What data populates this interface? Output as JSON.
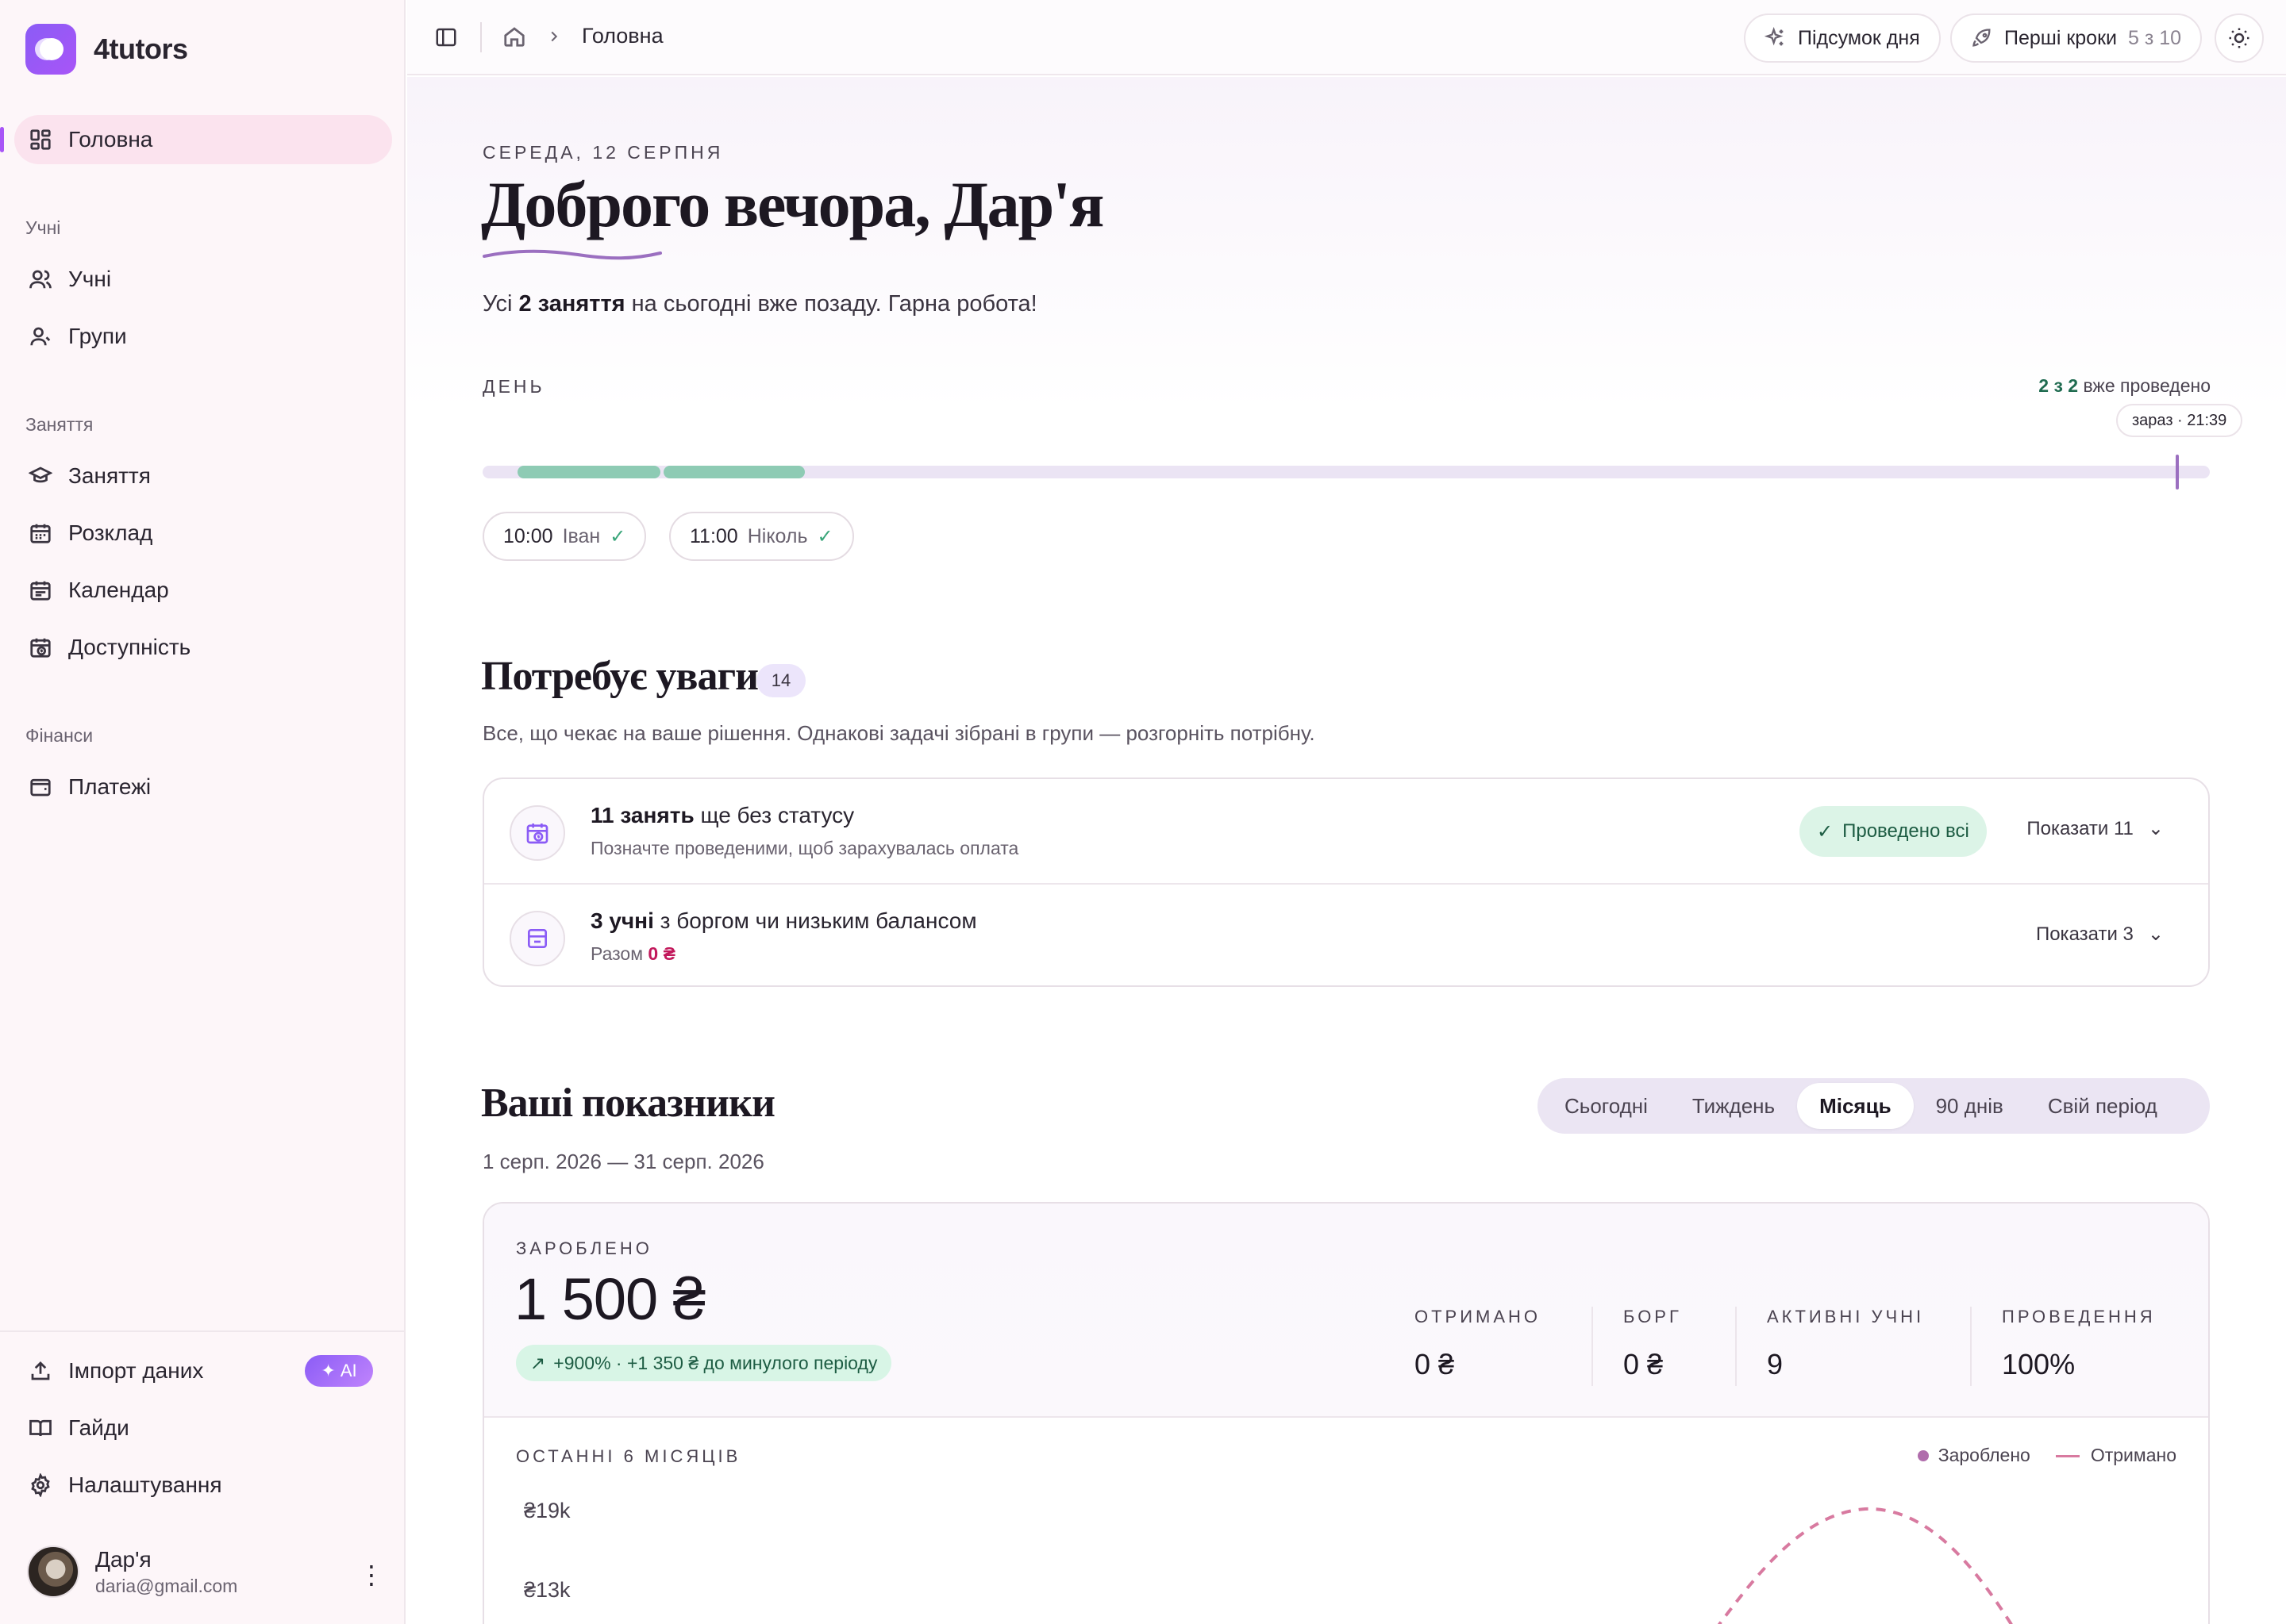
{
  "sidebar": {
    "brand": "4tutors",
    "home": "Головна",
    "sections": {
      "students": "Учні",
      "lessons": "Заняття",
      "finance": "Фінанси"
    },
    "items": {
      "students": "Учні",
      "groups": "Групи",
      "lessons": "Заняття",
      "schedule": "Розклад",
      "calendar": "Календар",
      "availability": "Доступність",
      "payments": "Платежі",
      "import": "Імпорт даних",
      "ai_badge": "AI",
      "guides": "Гайди",
      "settings": "Налаштування"
    },
    "user": {
      "name": "Дар'я",
      "email": "daria@gmail.com"
    }
  },
  "topbar": {
    "breadcrumb": "Головна",
    "day_summary": "Підсумок дня",
    "first_steps": "Перші кроки",
    "first_steps_progress": "5 з 10"
  },
  "hero": {
    "date": "СЕРЕДА, 12 СЕРПНЯ",
    "greeting": "Доброго вечора, Дар'я",
    "summary_prefix": "Усі ",
    "summary_bold": "2 заняття",
    "summary_suffix": " на сьогодні вже позаду. Гарна робота!"
  },
  "day": {
    "label": "ДЕНЬ",
    "done_bold": "2 з 2",
    "done_rest": " вже проведено",
    "now": "зараз · 21:39",
    "lessons": [
      {
        "time": "10:00",
        "name": "Іван"
      },
      {
        "time": "11:00",
        "name": "Ніколь"
      }
    ]
  },
  "attention": {
    "title": "Потребує уваги",
    "count": "14",
    "subtitle": "Все, що чекає на ваше рішення. Однакові задачі зібрані в групи — розгорніть потрібну.",
    "rows": [
      {
        "title_bold": "11 занять",
        "title_rest": " ще без статусу",
        "sub": "Позначте проведеними, щоб зарахувалась оплата",
        "action": "Проведено всі",
        "show": "Показати 11"
      },
      {
        "title_bold": "3 учні",
        "title_rest": " з боргом чи низьким балансом",
        "sub_prefix": "Разом ",
        "sub_value": "0 ₴",
        "show": "Показати 3"
      }
    ]
  },
  "metrics": {
    "title": "Ваші показники",
    "period_tabs": [
      "Сьогодні",
      "Тиждень",
      "Місяць",
      "90 днів",
      "Свій період"
    ],
    "active_tab": "Місяць",
    "period": "1 серп. 2026 — 31 серп. 2026",
    "earned_label": "ЗАРОБЛЕНО",
    "earned_value": "1 500 ₴",
    "growth": "+900% · +1 350 ₴ до минулого періоду",
    "kpis": [
      {
        "label": "ОТРИМАНО",
        "value": "0 ₴"
      },
      {
        "label": "БОРГ",
        "value": "0 ₴"
      },
      {
        "label": "АКТИВНІ УЧНІ",
        "value": "9"
      },
      {
        "label": "ПРОВЕДЕННЯ",
        "value": "100%"
      }
    ],
    "months_label": "ОСТАННІ 6 МІСЯЦІВ",
    "legend_earned": "Зароблено",
    "legend_received": "Отримано"
  },
  "chart_data": {
    "type": "line",
    "title": "ОСТАННІ 6 МІСЯЦІВ",
    "y_ticks": [
      "₴19k",
      "₴13k"
    ],
    "series": [
      {
        "name": "Зароблено",
        "color": "#b06dac"
      },
      {
        "name": "Отримано",
        "color": "#d87aa0",
        "style": "dashed"
      }
    ],
    "legend": "top-right"
  },
  "colors": {
    "accent": "#a855f7",
    "success": "#3aa67a",
    "danger": "#c2185b"
  }
}
